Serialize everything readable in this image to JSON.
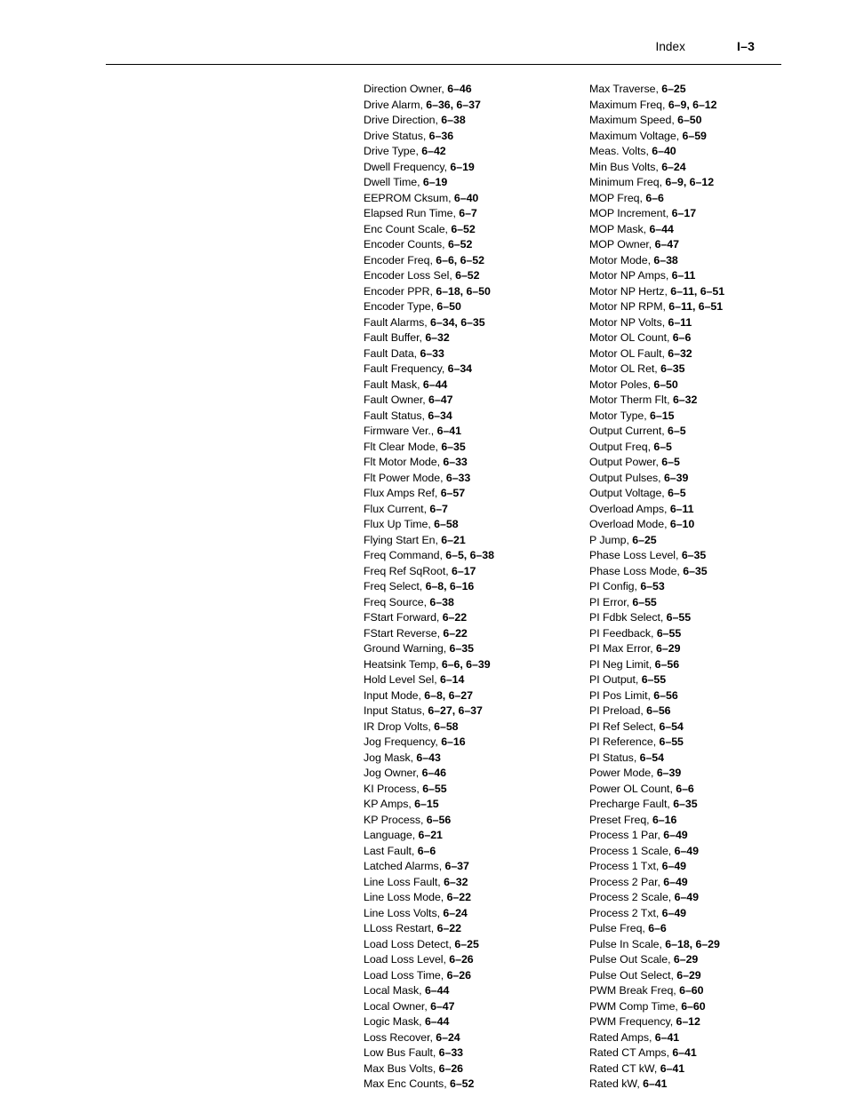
{
  "header": {
    "title": "Index",
    "folio": "I–3"
  },
  "index": {
    "columns": [
      {
        "name": "left",
        "entries": [
          {
            "term": "Direction Owner, ",
            "locators": "6–46"
          },
          {
            "term": "Drive Alarm, ",
            "locators": "6–36, 6–37"
          },
          {
            "term": "Drive Direction, ",
            "locators": "6–38"
          },
          {
            "term": "Drive Status, ",
            "locators": "6–36"
          },
          {
            "term": "Drive Type, ",
            "locators": "6–42"
          },
          {
            "term": "Dwell Frequency, ",
            "locators": "6–19"
          },
          {
            "term": "Dwell Time, ",
            "locators": "6–19"
          },
          {
            "term": "EEPROM Cksum, ",
            "locators": "6–40"
          },
          {
            "term": "Elapsed Run Time, ",
            "locators": "6–7"
          },
          {
            "term": "Enc Count Scale, ",
            "locators": "6–52"
          },
          {
            "term": "Encoder Counts, ",
            "locators": "6–52"
          },
          {
            "term": "Encoder Freq, ",
            "locators": "6–6, 6–52"
          },
          {
            "term": "Encoder Loss Sel, ",
            "locators": "6–52"
          },
          {
            "term": "Encoder PPR, ",
            "locators": "6–18, 6–50"
          },
          {
            "term": "Encoder Type, ",
            "locators": "6–50"
          },
          {
            "term": "Fault Alarms, ",
            "locators": "6–34, 6–35"
          },
          {
            "term": "Fault Buffer, ",
            "locators": "6–32"
          },
          {
            "term": "Fault Data, ",
            "locators": "6–33"
          },
          {
            "term": "Fault Frequency, ",
            "locators": "6–34"
          },
          {
            "term": "Fault Mask, ",
            "locators": "6–44"
          },
          {
            "term": "Fault Owner, ",
            "locators": "6–47"
          },
          {
            "term": "Fault Status, ",
            "locators": "6–34"
          },
          {
            "term": "Firmware Ver., ",
            "locators": "6–41"
          },
          {
            "term": "Flt Clear Mode, ",
            "locators": "6–35"
          },
          {
            "term": "Flt Motor Mode, ",
            "locators": "6–33"
          },
          {
            "term": "Flt Power Mode, ",
            "locators": "6–33"
          },
          {
            "term": "Flux Amps Ref, ",
            "locators": "6–57"
          },
          {
            "term": "Flux Current, ",
            "locators": "6–7"
          },
          {
            "term": "Flux Up Time, ",
            "locators": "6–58"
          },
          {
            "term": "Flying Start En, ",
            "locators": "6–21"
          },
          {
            "term": "Freq Command, ",
            "locators": "6–5, 6–38"
          },
          {
            "term": "Freq Ref SqRoot, ",
            "locators": "6–17"
          },
          {
            "term": "Freq Select, ",
            "locators": "6–8, 6–16"
          },
          {
            "term": "Freq Source, ",
            "locators": "6–38"
          },
          {
            "term": "FStart Forward, ",
            "locators": "6–22"
          },
          {
            "term": "FStart Reverse, ",
            "locators": "6–22"
          },
          {
            "term": "Ground Warning, ",
            "locators": "6–35"
          },
          {
            "term": "Heatsink Temp, ",
            "locators": "6–6, 6–39"
          },
          {
            "term": "Hold Level Sel, ",
            "locators": "6–14"
          },
          {
            "term": "Input Mode, ",
            "locators": "6–8, 6–27"
          },
          {
            "term": "Input Status, ",
            "locators": "6–27, 6–37"
          },
          {
            "term": "IR Drop Volts, ",
            "locators": "6–58"
          },
          {
            "term": "Jog Frequency, ",
            "locators": "6–16"
          },
          {
            "term": "Jog Mask, ",
            "locators": "6–43"
          },
          {
            "term": "Jog Owner, ",
            "locators": "6–46"
          },
          {
            "term": "KI Process, ",
            "locators": "6–55"
          },
          {
            "term": "KP Amps, ",
            "locators": "6–15"
          },
          {
            "term": "KP Process, ",
            "locators": "6–56"
          },
          {
            "term": "Language, ",
            "locators": "6–21"
          },
          {
            "term": "Last Fault, ",
            "locators": "6–6"
          },
          {
            "term": "Latched Alarms, ",
            "locators": "6–37"
          },
          {
            "term": "Line Loss Fault, ",
            "locators": "6–32"
          },
          {
            "term": "Line Loss Mode, ",
            "locators": "6–22"
          },
          {
            "term": "Line Loss Volts, ",
            "locators": "6–24"
          },
          {
            "term": "LLoss Restart, ",
            "locators": "6–22"
          },
          {
            "term": "Load Loss Detect, ",
            "locators": "6–25"
          },
          {
            "term": "Load Loss Level, ",
            "locators": "6–26"
          },
          {
            "term": "Load Loss Time, ",
            "locators": "6–26"
          },
          {
            "term": "Local Mask, ",
            "locators": "6–44"
          },
          {
            "term": "Local Owner, ",
            "locators": "6–47"
          },
          {
            "term": "Logic Mask, ",
            "locators": "6–44"
          },
          {
            "term": "Loss Recover, ",
            "locators": "6–24"
          },
          {
            "term": "Low Bus Fault, ",
            "locators": "6–33"
          },
          {
            "term": "Max Bus Volts, ",
            "locators": "6–26"
          },
          {
            "term": "Max Enc Counts, ",
            "locators": "6–52"
          }
        ]
      },
      {
        "name": "right",
        "entries": [
          {
            "term": "Max Traverse, ",
            "locators": "6–25"
          },
          {
            "term": "Maximum Freq, ",
            "locators": "6–9, 6–12"
          },
          {
            "term": "Maximum Speed, ",
            "locators": "6–50"
          },
          {
            "term": "Maximum Voltage, ",
            "locators": "6–59"
          },
          {
            "term": "Meas. Volts, ",
            "locators": "6–40"
          },
          {
            "term": "Min Bus Volts, ",
            "locators": "6–24"
          },
          {
            "term": "Minimum Freq, ",
            "locators": "6–9, 6–12"
          },
          {
            "term": "MOP Freq, ",
            "locators": "6–6"
          },
          {
            "term": "MOP Increment, ",
            "locators": "6–17"
          },
          {
            "term": "MOP Mask, ",
            "locators": "6–44"
          },
          {
            "term": "MOP Owner, ",
            "locators": "6–47"
          },
          {
            "term": "Motor Mode, ",
            "locators": "6–38"
          },
          {
            "term": "Motor NP Amps, ",
            "locators": "6–11"
          },
          {
            "term": "Motor NP Hertz, ",
            "locators": "6–11, 6–51"
          },
          {
            "term": "Motor NP RPM, ",
            "locators": "6–11, 6–51"
          },
          {
            "term": "Motor NP Volts, ",
            "locators": "6–11"
          },
          {
            "term": "Motor OL Count, ",
            "locators": "6–6"
          },
          {
            "term": "Motor OL Fault, ",
            "locators": "6–32"
          },
          {
            "term": "Motor OL Ret, ",
            "locators": "6–35"
          },
          {
            "term": "Motor Poles, ",
            "locators": "6–50"
          },
          {
            "term": "Motor Therm Flt, ",
            "locators": "6–32"
          },
          {
            "term": "Motor Type, ",
            "locators": "6–15"
          },
          {
            "term": "Output Current, ",
            "locators": "6–5"
          },
          {
            "term": "Output Freq, ",
            "locators": "6–5"
          },
          {
            "term": "Output Power, ",
            "locators": "6–5"
          },
          {
            "term": "Output Pulses, ",
            "locators": "6–39"
          },
          {
            "term": "Output Voltage, ",
            "locators": "6–5"
          },
          {
            "term": "Overload Amps, ",
            "locators": "6–11"
          },
          {
            "term": "Overload Mode, ",
            "locators": "6–10"
          },
          {
            "term": "P Jump, ",
            "locators": "6–25"
          },
          {
            "term": "Phase Loss Level, ",
            "locators": "6–35"
          },
          {
            "term": "Phase Loss Mode, ",
            "locators": "6–35"
          },
          {
            "term": "PI Config, ",
            "locators": "6–53"
          },
          {
            "term": "PI Error, ",
            "locators": "6–55"
          },
          {
            "term": "PI Fdbk Select, ",
            "locators": "6–55"
          },
          {
            "term": "PI Feedback, ",
            "locators": "6–55"
          },
          {
            "term": "PI Max Error, ",
            "locators": "6–29"
          },
          {
            "term": "PI Neg Limit, ",
            "locators": "6–56"
          },
          {
            "term": "PI Output, ",
            "locators": "6–55"
          },
          {
            "term": "PI Pos Limit, ",
            "locators": "6–56"
          },
          {
            "term": "PI Preload, ",
            "locators": "6–56"
          },
          {
            "term": "PI Ref Select, ",
            "locators": "6–54"
          },
          {
            "term": "PI Reference, ",
            "locators": "6–55"
          },
          {
            "term": "PI Status, ",
            "locators": "6–54"
          },
          {
            "term": "Power Mode, ",
            "locators": "6–39"
          },
          {
            "term": "Power OL Count, ",
            "locators": "6–6"
          },
          {
            "term": "Precharge Fault, ",
            "locators": "6–35"
          },
          {
            "term": "Preset Freq, ",
            "locators": "6–16"
          },
          {
            "term": "Process 1 Par, ",
            "locators": "6–49"
          },
          {
            "term": "Process 1 Scale, ",
            "locators": "6–49"
          },
          {
            "term": "Process 1 Txt, ",
            "locators": "6–49"
          },
          {
            "term": "Process 2 Par, ",
            "locators": "6–49"
          },
          {
            "term": "Process 2 Scale, ",
            "locators": "6–49"
          },
          {
            "term": "Process 2 Txt, ",
            "locators": "6–49"
          },
          {
            "term": "Pulse Freq, ",
            "locators": "6–6"
          },
          {
            "term": "Pulse In Scale, ",
            "locators": "6–18, 6–29"
          },
          {
            "term": "Pulse Out Scale, ",
            "locators": "6–29"
          },
          {
            "term": "Pulse Out Select, ",
            "locators": "6–29"
          },
          {
            "term": "PWM Break Freq, ",
            "locators": "6–60"
          },
          {
            "term": "PWM Comp Time, ",
            "locators": "6–60"
          },
          {
            "term": "PWM Frequency, ",
            "locators": "6–12"
          },
          {
            "term": "Rated Amps, ",
            "locators": "6–41"
          },
          {
            "term": "Rated CT Amps, ",
            "locators": "6–41"
          },
          {
            "term": "Rated CT kW, ",
            "locators": "6–41"
          },
          {
            "term": "Rated kW, ",
            "locators": "6–41"
          }
        ]
      }
    ]
  }
}
